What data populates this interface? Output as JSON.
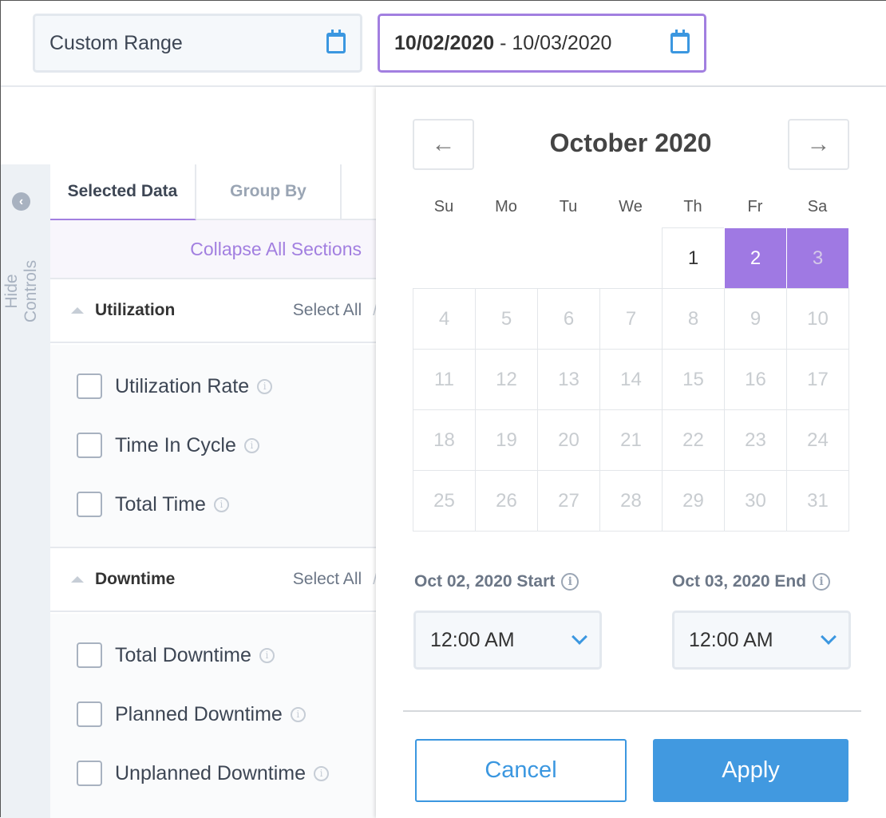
{
  "header": {
    "range_type": "Custom Range",
    "date_range_start": "10/02/2020",
    "date_range_sep": " - ",
    "date_range_end": "10/03/2020",
    "accent": "#a27fe0",
    "icon": "calendar-icon"
  },
  "sidebar": {
    "hide_controls": "Hide Controls"
  },
  "tabs": [
    {
      "label": "Selected Data",
      "active": true
    },
    {
      "label": "Group By",
      "active": false
    }
  ],
  "collapse_all": "Collapse All Sections",
  "sections": [
    {
      "title": "Utilization",
      "select_all": "Select All",
      "sep": "/",
      "items": [
        "Utilization Rate",
        "Time In Cycle",
        "Total Time"
      ]
    },
    {
      "title": "Downtime",
      "select_all": "Select All",
      "sep": "/",
      "items": [
        "Total Downtime",
        "Planned Downtime",
        "Unplanned Downtime"
      ]
    }
  ],
  "calendar": {
    "month_label": "October 2020",
    "prev": "←",
    "next": "→",
    "weekdays": [
      "Su",
      "Mo",
      "Tu",
      "We",
      "Th",
      "Fr",
      "Sa"
    ],
    "first_weekday": 4,
    "days_in_month": 31,
    "selected": [
      2,
      3
    ],
    "selected_color": "#9f79e3",
    "start_label": "Oct 02, 2020 Start",
    "end_label": "Oct 03, 2020 End",
    "start_time": "12:00 AM",
    "end_time": "12:00 AM"
  },
  "buttons": {
    "cancel": "Cancel",
    "apply": "Apply",
    "apply_color": "#4199e0"
  }
}
